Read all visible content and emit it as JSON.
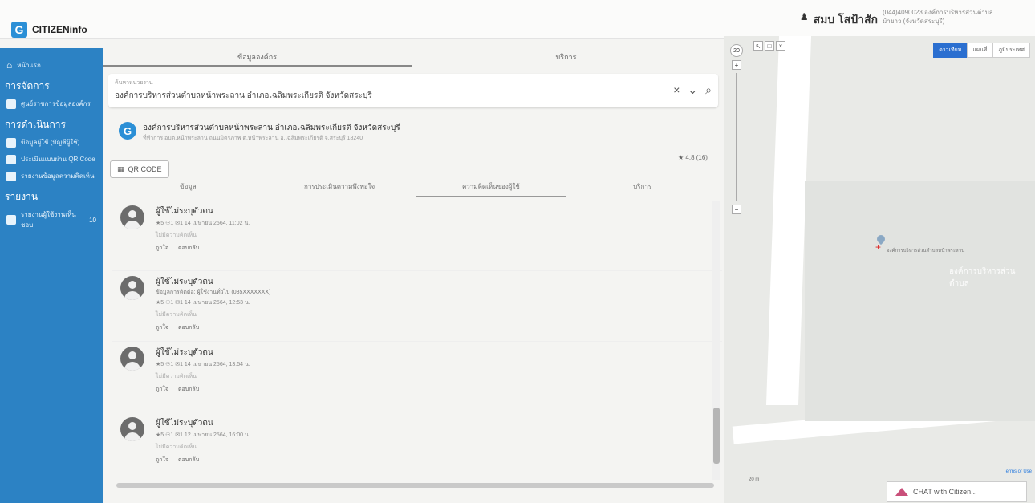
{
  "app": {
    "name": "CITIZENinfo",
    "logo_letter": "G"
  },
  "user": {
    "name": "สมบ โสป้าสัก",
    "org_line1": "(044)4090023 องค์การบริหารส่วนตำบล",
    "org_line2": "ม้ายาว (จังหวัดสระบุรี)"
  },
  "sidebar": {
    "home": "หน้าแรก",
    "section1": "การจัดการ",
    "manage_item": "ศูนย์ราชการข้อมูลองค์กร",
    "section2": "การดำเนินการ",
    "ops": [
      {
        "label": "ข้อมูลผู้ใช้ (บัญชีผู้ใช้)"
      },
      {
        "label": "ประเมินแบบผ่าน QR Code"
      },
      {
        "label": "รายงานข้อมูลความคิดเห็น"
      }
    ],
    "section3": "รายงาน",
    "report_item": "รายงานผู้ใช้งานเห็นชอบ",
    "report_badge": "10"
  },
  "tabs_top": [
    "ข้อมูลองค์กร",
    "บริการ"
  ],
  "search": {
    "label": "ค้นหาหน่วยงาน",
    "value": "องค์การบริหารส่วนตำบลหน้าพระลาน อำเภอเฉลิมพระเกียรติ จังหวัดสระบุรี",
    "clear": "×",
    "dropdown": "⌄",
    "search_icon": "⌕"
  },
  "org": {
    "name": "องค์การบริหารส่วนตำบลหน้าพระลาน อำเภอเฉลิมพระเกียรติ จังหวัดสระบุรี",
    "address": "ที่ทำการ อบต.หน้าพระลาน ถนนมิตรภาพ ต.หน้าพระลาน อ.เฉลิมพระเกียรติ จ.สระบุรี 18240"
  },
  "rating": "★ 4.8 (16)",
  "qr_button": "QR CODE",
  "tabs_inner": [
    "ข้อมูล",
    "การประเมินความพึงพอใจ",
    "ความคิดเห็นของผู้ใช้",
    "บริการ"
  ],
  "reviews": [
    {
      "name": "ผู้ใช้ไม่ระบุตัวตน",
      "sub": "",
      "meta": "★5 ⚇1 ✉1 14 เมษายน 2564, 11:02 น.",
      "text": "ไม่มีความคิดเห็น",
      "like": "ถูกใจ",
      "reply": "ตอบกลับ"
    },
    {
      "name": "ผู้ใช้ไม่ระบุตัวตน",
      "sub": "ข้อมูลการติดต่อ: ผู้ใช้งานทั่วไป (085XXXXXXX)",
      "meta": "★5 ⚇1 ✉1 14 เมษายน 2564, 12:53 น.",
      "text": "ไม่มีความคิดเห็น",
      "like": "ถูกใจ",
      "reply": "ตอบกลับ"
    },
    {
      "name": "ผู้ใช้ไม่ระบุตัวตน",
      "sub": "",
      "meta": "★5 ⚇1 ✉1 14 เมษายน 2564, 13:54 น.",
      "text": "ไม่มีความคิดเห็น",
      "like": "ถูกใจ",
      "reply": "ตอบกลับ"
    },
    {
      "name": "ผู้ใช้ไม่ระบุตัวตน",
      "sub": "",
      "meta": "★5 ⚇1 ✉1 12 เมษายน 2564, 16:00 น.",
      "text": "ไม่มีความคิดเห็น",
      "like": "ถูกใจ",
      "reply": "ตอบกลับ"
    }
  ],
  "map": {
    "types": [
      "ดาวเทียม",
      "แผนที่",
      "ภูมิประเทศ"
    ],
    "zoom_label": "20",
    "pin_label": "องค์การบริหารส่วนตำบลหน้าพระลาน",
    "pin_label2": "องค์การบริหารส่วนตำบล",
    "scale": "20 m",
    "terms": "Terms of Use"
  },
  "chat": "CHAT with Citizen..."
}
